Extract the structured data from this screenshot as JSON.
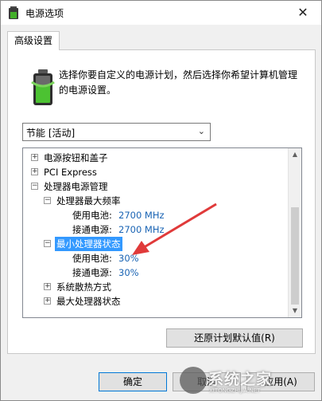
{
  "window": {
    "title": "电源选项",
    "close_glyph": "✕"
  },
  "tab": {
    "label": "高级设置"
  },
  "description": "选择你要自定义的电源计划，然后选择你希望计算机管理的电源设置。",
  "plan_select": {
    "value": "节能 [活动]"
  },
  "tree": {
    "items": [
      {
        "label": "电源按钮和盖子",
        "expander": "+"
      },
      {
        "label": "PCI Express",
        "expander": "+"
      },
      {
        "label": "处理器电源管理",
        "expander": "−"
      },
      {
        "label": "处理器最大频率",
        "expander": "−"
      },
      {
        "label": "使用电池:",
        "value": "2700 MHz"
      },
      {
        "label": "接通电源:",
        "value": "2700 MHz"
      },
      {
        "label": "最小处理器状态",
        "expander": "−"
      },
      {
        "label": "使用电池:",
        "value": "30%"
      },
      {
        "label": "接通电源:",
        "value": "30%"
      },
      {
        "label": "系统散热方式",
        "expander": "+"
      },
      {
        "label": "最大处理器状态",
        "expander": "+"
      }
    ]
  },
  "buttons": {
    "restore": "还原计划默认值(R)",
    "ok": "确定",
    "cancel": "取消",
    "apply": "应用(A)"
  },
  "watermark": {
    "text": "系统之家",
    "sub": "XITONGZHIJIA.NET"
  },
  "colors": {
    "selection": "#3399ff",
    "value_link": "#1a64b4",
    "arrow": "#e03a3a"
  }
}
